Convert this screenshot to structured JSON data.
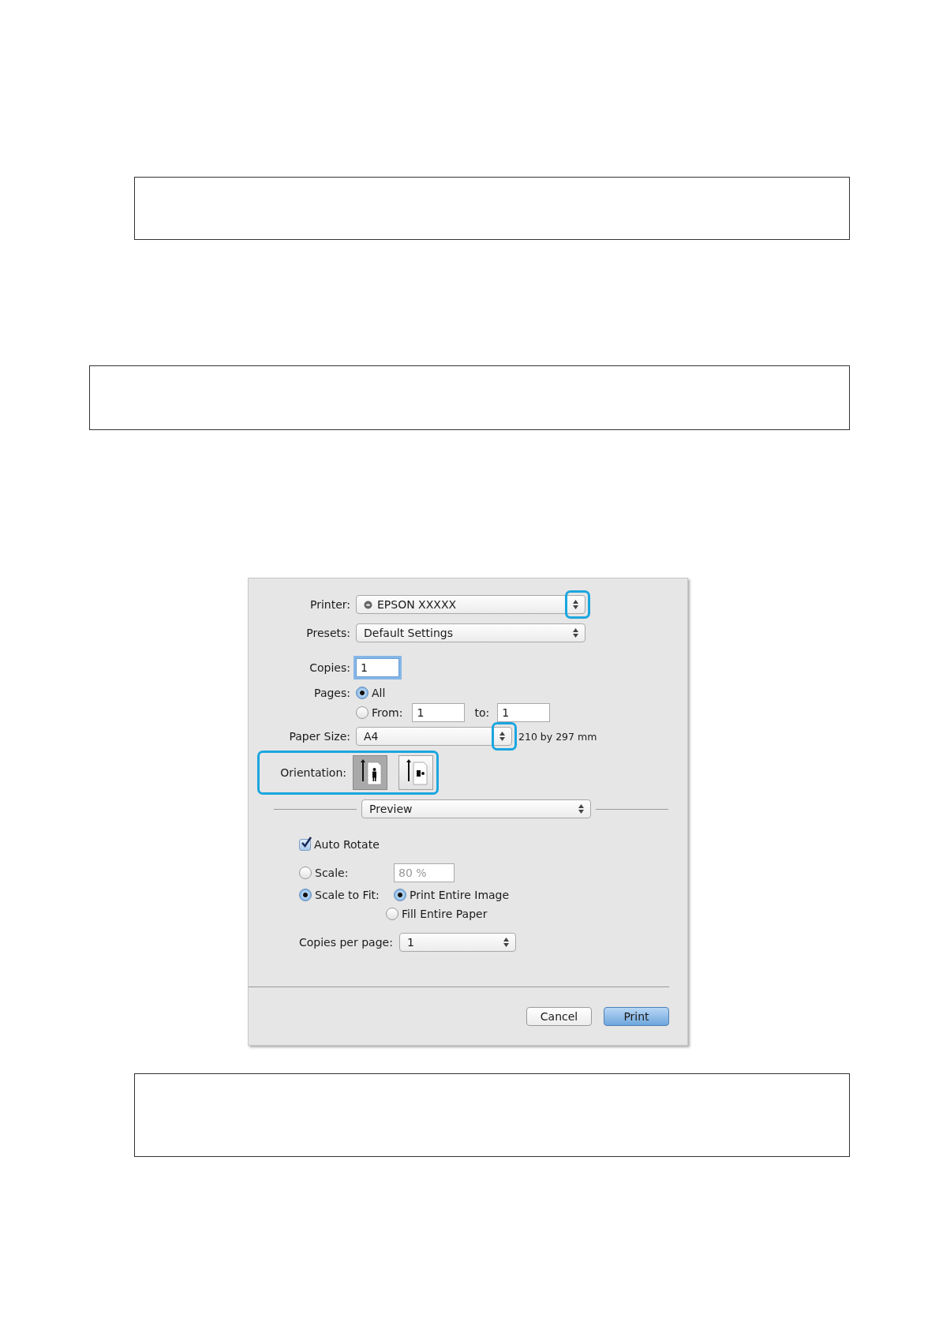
{
  "dialog": {
    "printer": {
      "label": "Printer:",
      "value": "EPSON XXXXX",
      "highlighted": true
    },
    "presets": {
      "label": "Presets:",
      "value": "Default Settings"
    },
    "copies": {
      "label": "Copies:",
      "value": "1"
    },
    "pages": {
      "label": "Pages:",
      "options": [
        {
          "label": "All",
          "selected": true
        },
        {
          "label": "From:",
          "selected": false
        }
      ],
      "from": "1",
      "to_label": "to:",
      "to": "1"
    },
    "paper_size": {
      "label": "Paper Size:",
      "value": "A4",
      "dimensions": "210 by 297 mm",
      "highlighted": true
    },
    "orientation": {
      "label": "Orientation:",
      "highlighted": true,
      "options": [
        {
          "kind": "portrait",
          "selected": true
        },
        {
          "kind": "landscape",
          "selected": false
        }
      ]
    },
    "section": {
      "value": "Preview"
    },
    "auto_rotate": {
      "label": "Auto Rotate",
      "checked": true
    },
    "scale_modes": [
      {
        "label": "Scale:",
        "selected": false
      },
      {
        "label": "Scale to Fit:",
        "selected": true
      }
    ],
    "scale": {
      "value": "80 %",
      "disabled": true
    },
    "fit_options": [
      {
        "label": "Print Entire Image",
        "selected": true
      },
      {
        "label": "Fill Entire Paper",
        "selected": false
      }
    ],
    "copies_per_page": {
      "label": "Copies per page:",
      "value": "1"
    },
    "buttons": [
      {
        "label": "Cancel",
        "kind": "default"
      },
      {
        "label": "Print",
        "kind": "primary"
      }
    ]
  }
}
